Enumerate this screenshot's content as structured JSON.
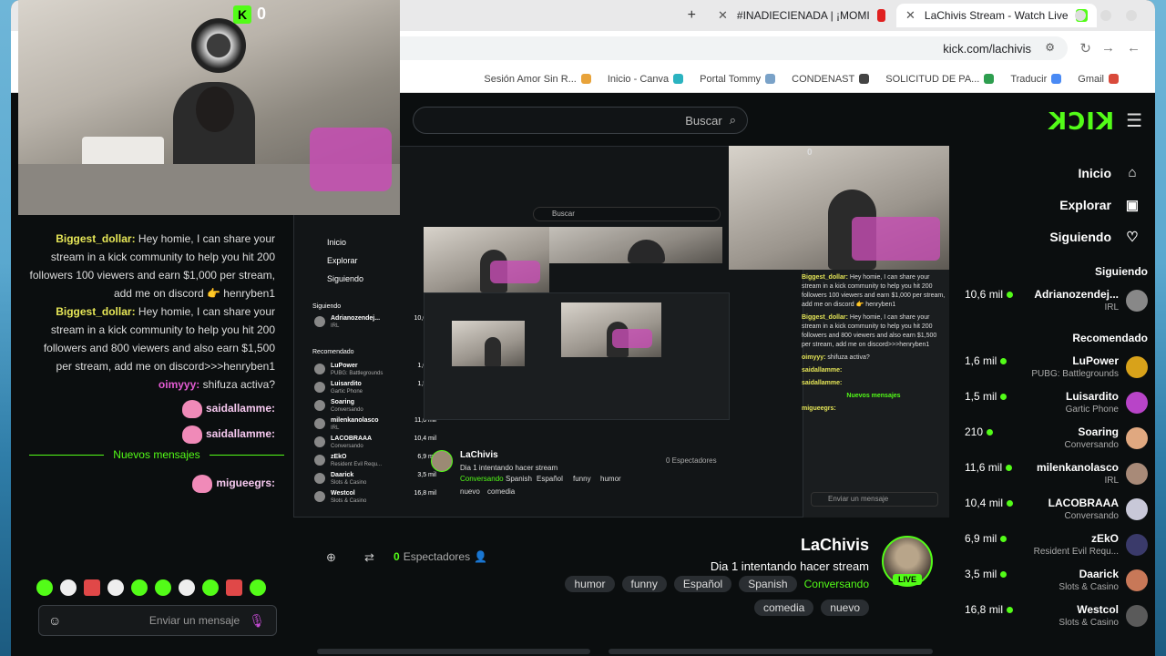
{
  "browser": {
    "tabs": [
      {
        "label": "LaChivis Stream - Watch Live",
        "color": "#53fc18"
      },
      {
        "label": "#INADIECIENADA | ¡MOMI",
        "color": "#e02020"
      }
    ],
    "new_tab": "+",
    "url": "kick.com/lachivis",
    "bookmarks": [
      {
        "label": "Gmail",
        "color": "#d94a3b"
      },
      {
        "label": "Traducir",
        "color": "#4a8af4"
      },
      {
        "label": "SOLICITUD DE PA...",
        "color": "#2e9e4f"
      },
      {
        "label": "CONDENAST",
        "color": "#444444"
      },
      {
        "label": "Portal Tommy",
        "color": "#7aa2c8"
      },
      {
        "label": "Inicio - Canva",
        "color": "#2bb3c0"
      },
      {
        "label": "Sesión Amor Sin R...",
        "color": "#e8a33a"
      }
    ]
  },
  "kick": {
    "search_placeholder": "Buscar",
    "logo": "KICK",
    "nav": [
      {
        "label": "Inicio",
        "icon": "home-icon",
        "glyph": "⌂"
      },
      {
        "label": "Explorar",
        "icon": "explore-icon",
        "glyph": "▣"
      },
      {
        "label": "Siguiendo",
        "icon": "heart-icon",
        "glyph": "♡"
      }
    ],
    "following_title": "Siguiendo",
    "following": [
      {
        "name": "Adrianozendej...",
        "sub": "IRL",
        "viewers": "10,6 mil",
        "color": "#888888"
      }
    ],
    "recommended_title": "Recomendado",
    "recommended": [
      {
        "name": "LuPower",
        "sub": "PUBG: Battlegrounds",
        "viewers": "1,6 mil",
        "color": "#d8a21a"
      },
      {
        "name": "Luisardito",
        "sub": "Gartic Phone",
        "viewers": "1,5 mil",
        "color": "#b844c8"
      },
      {
        "name": "Soaring",
        "sub": "Conversando",
        "viewers": "210",
        "color": "#e0a880"
      },
      {
        "name": "milenkanolasco",
        "sub": "IRL",
        "viewers": "11,6 mil",
        "color": "#a88a78"
      },
      {
        "name": "LACOBRAAA",
        "sub": "Conversando",
        "viewers": "10,4 mil",
        "color": "#c8c8d8"
      },
      {
        "name": "zEkO",
        "sub": "Resident Evil Requ...",
        "viewers": "6,9 mil",
        "color": "#3a3a6a"
      },
      {
        "name": "Daarick",
        "sub": "Slots & Casino",
        "viewers": "3,5 mil",
        "color": "#c87858"
      },
      {
        "name": "Westcol",
        "sub": "Slots & Casino",
        "viewers": "16,8 mil",
        "color": "#5a5a5a"
      }
    ]
  },
  "cam": {
    "kick_count": "0"
  },
  "chat": {
    "messages": [
      {
        "user": "Biggest_dollar:",
        "text": "Hey homie, I can share your stream in a kick community to help you hit 200 followers 100 viewers and earn $1,000 per stream, add me on discord 👉 henryben1"
      },
      {
        "user": "Biggest_dollar:",
        "text": "Hey homie, I can share your stream in a kick community to help you hit 200 followers and 800 viewers and also earn $1,500 per stream, add me on discord>>>henryben1"
      },
      {
        "user": "oimyyy:",
        "text": "shifuza activa?"
      },
      {
        "user": "saidallamme:",
        "text": ""
      },
      {
        "user": "saidallamme:",
        "text": ""
      },
      {
        "user": "migueegrs:",
        "text": ""
      }
    ],
    "new_messages": "Nuevos mensajes",
    "input_placeholder": "Enviar un mensaje"
  },
  "player": {
    "channel_name": "LaChivis",
    "title": "Dia 1 intentando hacer stream",
    "viewers": "0 Espectadores",
    "category": "Conversando",
    "tags": [
      "Spanish",
      "Español",
      "funny",
      "humor"
    ],
    "tags_row2": [
      "nuevo",
      "comedia"
    ],
    "nav": [
      "Inicio",
      "Explorar",
      "Siguiendo"
    ],
    "following_title": "Siguiendo",
    "recommended_title": "Recomendado",
    "channels": [
      {
        "name": "Adrianozendej...",
        "sub": "IRL",
        "viewers": "10,6 mil"
      },
      {
        "name": "LuPower",
        "sub": "PUBG: Battlegrounds",
        "viewers": "1,6 mil"
      },
      {
        "name": "Luisardito",
        "sub": "Gartic Phone",
        "viewers": "1,5 mil"
      },
      {
        "name": "Soaring",
        "sub": "Conversando",
        "viewers": "210"
      },
      {
        "name": "milenkanolasco",
        "sub": "IRL",
        "viewers": "11,6 mil"
      },
      {
        "name": "LACOBRAAA",
        "sub": "Conversando",
        "viewers": "10,4 mil"
      },
      {
        "name": "zEkO",
        "sub": "Resident Evil Requ...",
        "viewers": "6,9 mil"
      },
      {
        "name": "Daarick",
        "sub": "Slots & Casino",
        "viewers": "3,5 mil"
      },
      {
        "name": "Westcol",
        "sub": "Slots & Casino",
        "viewers": "16,8 mil"
      }
    ],
    "search": "Buscar",
    "input_placeholder": "Enviar un mensaje",
    "chat": [
      {
        "user": "Biggest_dollar:",
        "text": "Hey homie, I can share your stream in a kick community to help you hit 200 followers 100 viewers and earn $1,000 per stream, add me on discord 👉 henryben1"
      },
      {
        "user": "Biggest_dollar:",
        "text": "Hey homie, I can share your stream in a kick community to help you hit 200 followers and 800 viewers and also earn $1,500 per stream, add me on discord>>>henryben1"
      },
      {
        "user": "oimyyy:",
        "text": "shifuza activa?"
      },
      {
        "user": "saidallamme:",
        "text": ""
      },
      {
        "user": "saidallamme:",
        "text": ""
      },
      {
        "user": "Nuevos mensajes",
        "text": ""
      },
      {
        "user": "migueegrs:",
        "text": ""
      }
    ],
    "cam_count": "0"
  },
  "stream": {
    "name": "LaChivis",
    "title": "Dia 1 intentando hacer stream",
    "category": "Conversando",
    "tags": [
      "Spanish",
      "Español",
      "funny",
      "humor"
    ],
    "tags_row2": [
      "nuevo",
      "comedia"
    ],
    "viewers_count": "0",
    "viewers_label": "Espectadores",
    "live": "LIVE"
  },
  "colors": {
    "accent": "#53fc18",
    "bg": "#0b0e0f"
  }
}
